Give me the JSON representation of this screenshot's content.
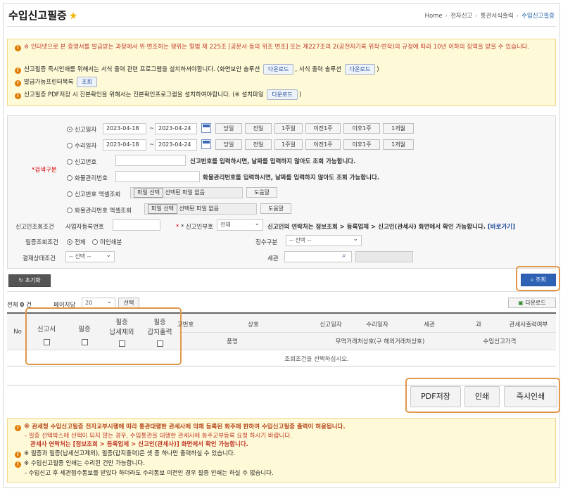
{
  "page": {
    "title": "수입신고필증",
    "breadcrumb": [
      "Home",
      "전자신고",
      "통관서식출력",
      "수입신고필증"
    ]
  },
  "notices": [
    {
      "text": "※ 인터넷으로 본 증명서를 발급받는 과정에서 위·변조하는 행위는 형법 제 225조 [공문서 등의 위조 변조] 또는 제227조의 2(공전자기록 위작·변작)의 규정에 따라 10년 이하의 징역을 받을 수 있습니다."
    },
    {
      "text_a": "신고필증 즉시인쇄를 위해서는 서식 출력 관련 프로그램을 설치하셔야합니다. (화면보안 솔루션",
      "btn_a": "다운로드",
      "text_b": ", 서식 출력 솔루션",
      "btn_b": "다운로드",
      "text_c": ")"
    },
    {
      "text_a": "발급가능프린터목록",
      "btn_a": "조회"
    },
    {
      "text_a": "신고필증 PDF저장 시 진본확인을 위해서는 진본확인프로그램을 설치하여야합니다. (※ 설치파일",
      "btn_a": "다운로드",
      "text_c": ")"
    }
  ],
  "search": {
    "label": "*검색구분",
    "report_date": "신고일자",
    "accept_date": "수리일자",
    "date_from": "2023-04-18",
    "tilde": "~",
    "date_to": "2023-04-24",
    "periods": [
      "당일",
      "전일",
      "1주일",
      "이전1주",
      "이후1주",
      "1개월"
    ],
    "report_no": "신고번호",
    "report_no_hint": "신고번호를 입력하시면, 날짜를 입력하지 않아도 조회 가능합니다.",
    "cargo_no": "화물관리번호",
    "cargo_no_hint": "화물관리번호를 입력하시면, 날짜를 입력하지 않아도 조회 가능합니다.",
    "excel_report": "신고번호 엑셀조회",
    "excel_cargo": "화물관리번호 엑셀조회",
    "file_btn": "파일 선택",
    "file_none": "선택된 파일 없음",
    "help": "도움말",
    "reporter_label": "신고인조회조건",
    "biz_no": "사업자등록번호",
    "reporter_part": "* 신고인부호",
    "reporter_sel": "전체",
    "reporter_hint": "신고인의 연락처는 정보조회 > 등록업체 > 신고인(관세사) 화면에서 확인 가능합니다.",
    "goto": "[바로가기]",
    "cert_label": "필증조회조건",
    "cert_all": "전체",
    "cert_un": "미인쇄분",
    "collect_label": "징수구분",
    "collect_sel": "-- 선택 --",
    "pay_label": "결재상태조건",
    "pay_sel": "-- 선택 --",
    "customs_label": "세관"
  },
  "actions": {
    "reset": "초기화",
    "query": "조회"
  },
  "list": {
    "total_label": "전체",
    "total": "0",
    "unit": "건",
    "per_page_label": "페이지당",
    "per_page": "20",
    "select": "선택",
    "download": "다운로드"
  },
  "table": {
    "no": "No",
    "chk": [
      "신고서",
      "필증",
      "필증\n납세제외",
      "필증\n갑지출력"
    ],
    "cols": [
      "신고번호",
      "상호",
      "신고일자",
      "수리일자",
      "세관",
      "과",
      "관세사출력여부"
    ],
    "cols2": [
      "품명",
      "무역거래처상호(구 해외거래처상호)",
      "수입신고가격"
    ],
    "empty": "조회조건을 선택하십시오."
  },
  "bottom_buttons": [
    "PDF저장",
    "인쇄",
    "즉시인쇄"
  ],
  "footer": [
    {
      "t": "※ 관세청 수입신고필증 전자교부시행에 따라 통관대행한 관세사에 의해 등록된 화주에 한하여 수입신고필증 출력이 허용됩니다."
    },
    {
      "t": "- 필증 선택박스에 선택이 되지 않는 경우, 수입통관을 대행한 관세사에 화주교부등록 요청 하시기 바랍니다."
    },
    {
      "t": "관세사 연락처는 [정보조회 > 등록업체 > 신고인(관세사)] 화면에서 확인 가능합니다."
    },
    {
      "t": "※ 필증과 필증(납세신고제외), 필증(갑지출력)은 셋 중 하나만 출력하실 수 있습니다."
    },
    {
      "t": "※ 수입신고필증 인쇄는 수리된 건만 가능합니다."
    },
    {
      "t": "- 수입신고 후 세관접수통보를 받았다 하더라도 수리통보 이전인 경우 필증 인쇄는 하실 수 없습니다."
    }
  ]
}
